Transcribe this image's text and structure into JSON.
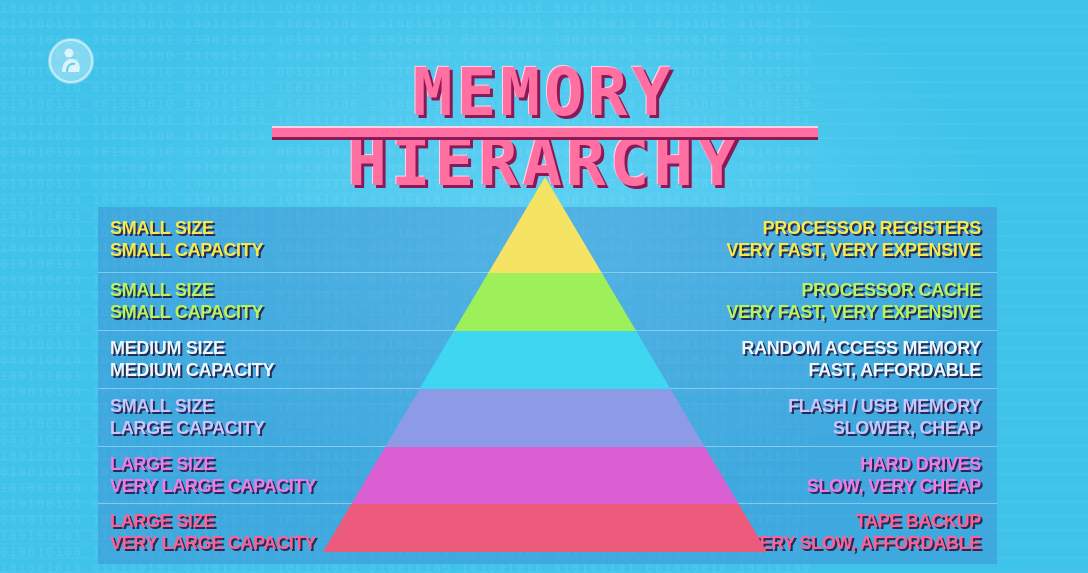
{
  "title": "MEMORY HIERARCHY",
  "logo_icon": "pbs-logo-icon",
  "colors": {
    "background": "#3fc3ea",
    "title": "#ff6fa2",
    "title_shadow": "#8a1a56"
  },
  "levels": [
    {
      "left_line1": "SMALL SIZE",
      "left_line2": "SMALL CAPACITY",
      "right_line1": "PROCESSOR REGISTERS",
      "right_line2": "VERY FAST, VERY EXPENSIVE",
      "color": "#f5e463",
      "text_color": "#f6e94a"
    },
    {
      "left_line1": "SMALL SIZE",
      "left_line2": "SMALL CAPACITY",
      "right_line1": "PROCESSOR CACHE",
      "right_line2": "VERY FAST, VERY EXPENSIVE",
      "color": "#9ef05a",
      "text_color": "#b6f55e"
    },
    {
      "left_line1": "MEDIUM SIZE",
      "left_line2": "MEDIUM CAPACITY",
      "right_line1": "RANDOM ACCESS MEMORY",
      "right_line2": "FAST, AFFORDABLE",
      "color": "#3fd6f2",
      "text_color": "#e9f8ff"
    },
    {
      "left_line1": "SMALL SIZE",
      "left_line2": "LARGE CAPACITY",
      "right_line1": "FLASH / USB MEMORY",
      "right_line2": "SLOWER, CHEAP",
      "color": "#8d9be6",
      "text_color": "#c9c5ff"
    },
    {
      "left_line1": "LARGE SIZE",
      "left_line2": "VERY LARGE CAPACITY",
      "right_line1": "HARD DRIVES",
      "right_line2": "SLOW, VERY CHEAP",
      "color": "#d95fd2",
      "text_color": "#f07be6"
    },
    {
      "left_line1": "LARGE SIZE",
      "left_line2": "VERY LARGE CAPACITY",
      "right_line1": "TAPE BACKUP",
      "right_line2": "VERY SLOW, AFFORDABLE",
      "color": "#ec5a7c",
      "text_color": "#ff5f93"
    }
  ]
}
